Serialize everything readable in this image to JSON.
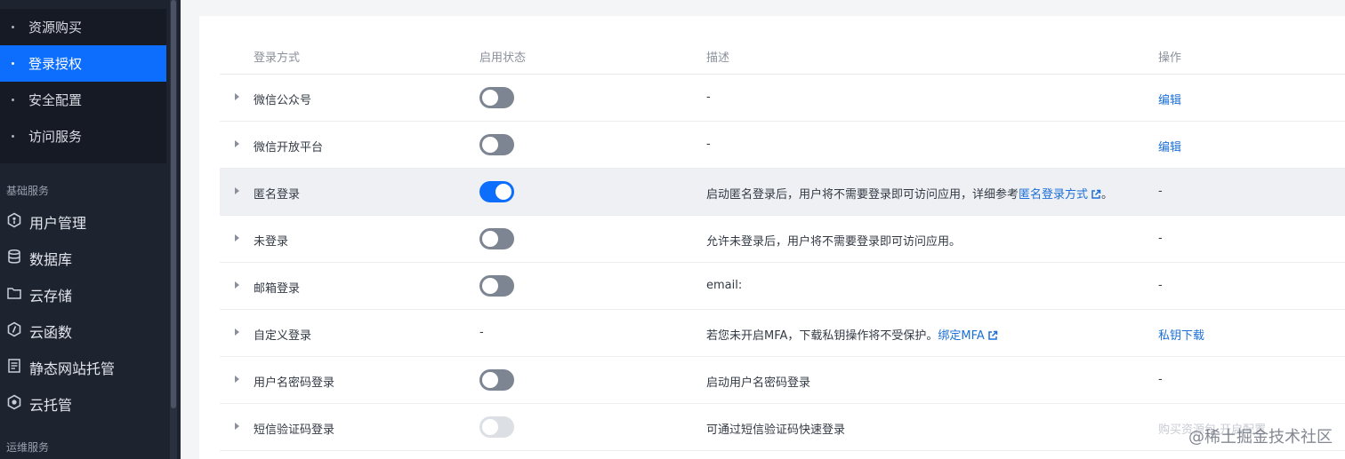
{
  "sidebar": {
    "sub_items": [
      {
        "label": "资源购买",
        "active": false
      },
      {
        "label": "登录授权",
        "active": true
      },
      {
        "label": "安全配置",
        "active": false
      },
      {
        "label": "访问服务",
        "active": false
      }
    ],
    "group_basic": "基础服务",
    "nav_items": [
      {
        "label": "用户管理",
        "icon": "user-manage-icon"
      },
      {
        "label": "数据库",
        "icon": "database-icon"
      },
      {
        "label": "云存储",
        "icon": "folder-icon"
      },
      {
        "label": "云函数",
        "icon": "function-icon"
      },
      {
        "label": "静态网站托管",
        "icon": "document-icon"
      },
      {
        "label": "云托管",
        "icon": "hexagon-icon"
      }
    ],
    "group_ops": "运维服务"
  },
  "table": {
    "headers": {
      "method": "登录方式",
      "status": "启用状态",
      "desc": "描述",
      "action": "操作"
    },
    "rows": [
      {
        "method": "微信公众号",
        "status": "off",
        "desc": "-",
        "action": "编辑"
      },
      {
        "method": "微信开放平台",
        "status": "off",
        "desc": "-",
        "action": "编辑"
      },
      {
        "method": "匿名登录",
        "status": "on",
        "desc": "启动匿名登录后，用户将不需要登录即可访问应用，详细参考",
        "desc_link": "匿名登录方式",
        "desc_suffix": "。",
        "action": "-"
      },
      {
        "method": "未登录",
        "status": "off",
        "desc": "允许未登录后，用户将不需要登录即可访问应用。",
        "action": "-"
      },
      {
        "method": "邮箱登录",
        "status": "off",
        "desc": "email:",
        "action": "-"
      },
      {
        "method": "自定义登录",
        "status": "-",
        "desc": "若您未开启MFA，下载私钥操作将不受保护。",
        "desc_link": "绑定MFA",
        "action": "私钥下载"
      },
      {
        "method": "用户名密码登录",
        "status": "off",
        "desc": "启动用户名密码登录",
        "action": "-"
      },
      {
        "method": "短信验证码登录",
        "status": "disabled",
        "desc": "可通过短信验证码快速登录",
        "action": "购买资源包  开启配置"
      }
    ]
  },
  "watermark": "@稀土掘金技术社区",
  "colors": {
    "sidebar": "#1e2330",
    "active": "#0d6efd",
    "link": "#1b6fd8"
  }
}
